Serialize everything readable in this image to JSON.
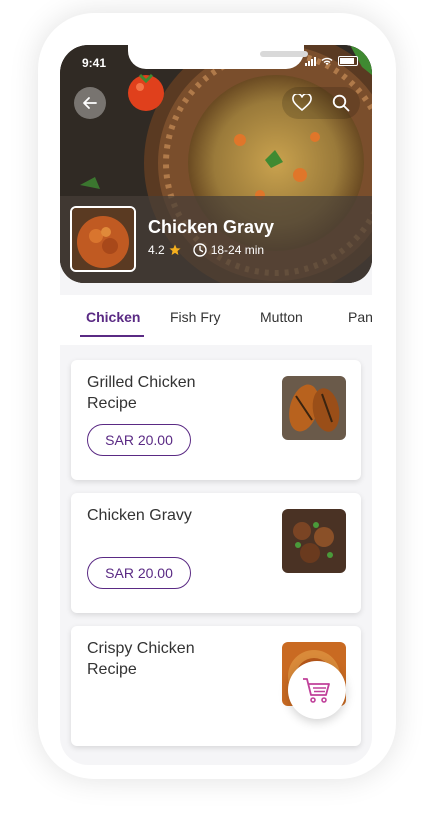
{
  "status": {
    "time": "9:41"
  },
  "hero": {
    "title": "Chicken Gravy",
    "rating": "4.2",
    "time": "18-24 min"
  },
  "tabs": [
    {
      "label": "Chicken",
      "active": true
    },
    {
      "label": "Fish Fry",
      "active": false
    },
    {
      "label": "Mutton",
      "active": false
    },
    {
      "label": "Pan",
      "active": false
    }
  ],
  "items": [
    {
      "title": "Grilled Chicken Recipe",
      "price": "SAR 20.00"
    },
    {
      "title": "Chicken Gravy",
      "price": "SAR 20.00"
    },
    {
      "title": "Crispy Chicken Recipe"
    }
  ],
  "colors": {
    "accent": "#5a2a84",
    "star": "#f6b01e"
  },
  "icons": [
    "back-arrow-icon",
    "heart-icon",
    "search-icon",
    "star-icon",
    "clock-icon",
    "cart-icon"
  ]
}
